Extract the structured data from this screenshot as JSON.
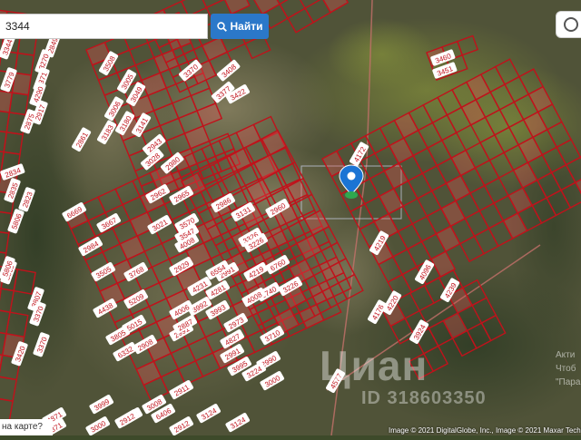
{
  "search": {
    "value": "3344",
    "button_label": "Найти",
    "icon": "search-icon"
  },
  "map_link": {
    "label": "на карте?"
  },
  "watermark": {
    "brand": "Циан",
    "listing_id": "ID 318603350"
  },
  "attribution": {
    "text": "Image © 2021 DigitalGlobe, Inc., Image © 2021 Maxar Technologies"
  },
  "activation": {
    "lines": [
      "Акти",
      "Чтоб",
      "\"Пара"
    ]
  },
  "toggle": {
    "icon": "layers-toggle-icon"
  },
  "marker": {
    "icon": "location-pin-icon"
  },
  "colors": {
    "boundary": "#c0121b",
    "button": "#2b78c9",
    "marker": "#1b74d4",
    "marker_dot": "#2fa84f"
  },
  "left_block_labels": [
    "3344",
    "2849",
    "3270",
    "3779",
    "3371",
    "4290",
    "2917",
    "2875",
    "2834",
    "2835",
    "2823",
    "5806",
    "5809",
    "3807",
    "3508",
    "3005",
    "3006",
    "3049",
    "3180",
    "3183",
    "3141",
    "2861",
    "2943",
    "3028",
    "2980",
    "3370",
    "3408",
    "3460",
    "3451",
    "3422",
    "3377"
  ],
  "mid_block_labels": [
    "2986",
    "3131",
    "3326",
    "4008",
    "2965",
    "2962",
    "3021",
    "3570",
    "3547",
    "3505",
    "6669",
    "3667",
    "2984",
    "3768",
    "5209",
    "4438",
    "5015",
    "4231",
    "4281",
    "3805",
    "6332",
    "2908",
    "2991",
    "3993",
    "2887",
    "2991",
    "4219",
    "3226",
    "2960",
    "6760",
    "6740",
    "6554",
    "3992",
    "4008",
    "3226",
    "2929",
    "4006",
    "2973",
    "3710",
    "2991",
    "4827",
    "3995",
    "2990",
    "3224",
    "2911",
    "2912",
    "6406"
  ],
  "right_block_labels": [
    "4577",
    "4219",
    "4176",
    "4220",
    "3924",
    "4172",
    "4096",
    "4239"
  ],
  "lower_left_labels": [
    "3420",
    "5806",
    "3370",
    "3370",
    "4871",
    "4871",
    "3124",
    "3999",
    "3000",
    "2912",
    "3008",
    "3124",
    "2912",
    "3000"
  ]
}
